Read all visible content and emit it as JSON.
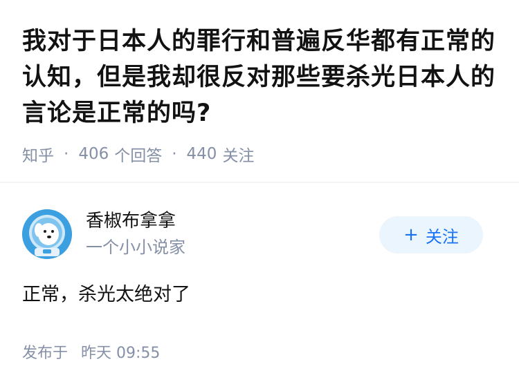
{
  "question": {
    "title": "我对于日本人的罪行和普遍反华都有正常的认知，但是我却很反对那些要杀光日本人的言论是正常的吗?",
    "source": "知乎",
    "answers_count": "406",
    "answers_label": "个回答",
    "followers_count": "440",
    "followers_label": "关注"
  },
  "answer": {
    "author": {
      "name": "香椒布拿拿",
      "bio": "一个小小说家",
      "avatar_icon": "dog-astronaut-avatar"
    },
    "follow_button": {
      "icon": "+",
      "label": "关注"
    },
    "content": "正常，杀光太绝对了",
    "published_label": "发布于",
    "published_time": "昨天 09:55"
  },
  "colors": {
    "accent": "#1772f6",
    "follow_bg": "#ebf5fd",
    "meta_text": "#8590a6",
    "avatar_bg": "#3b9fe0"
  }
}
